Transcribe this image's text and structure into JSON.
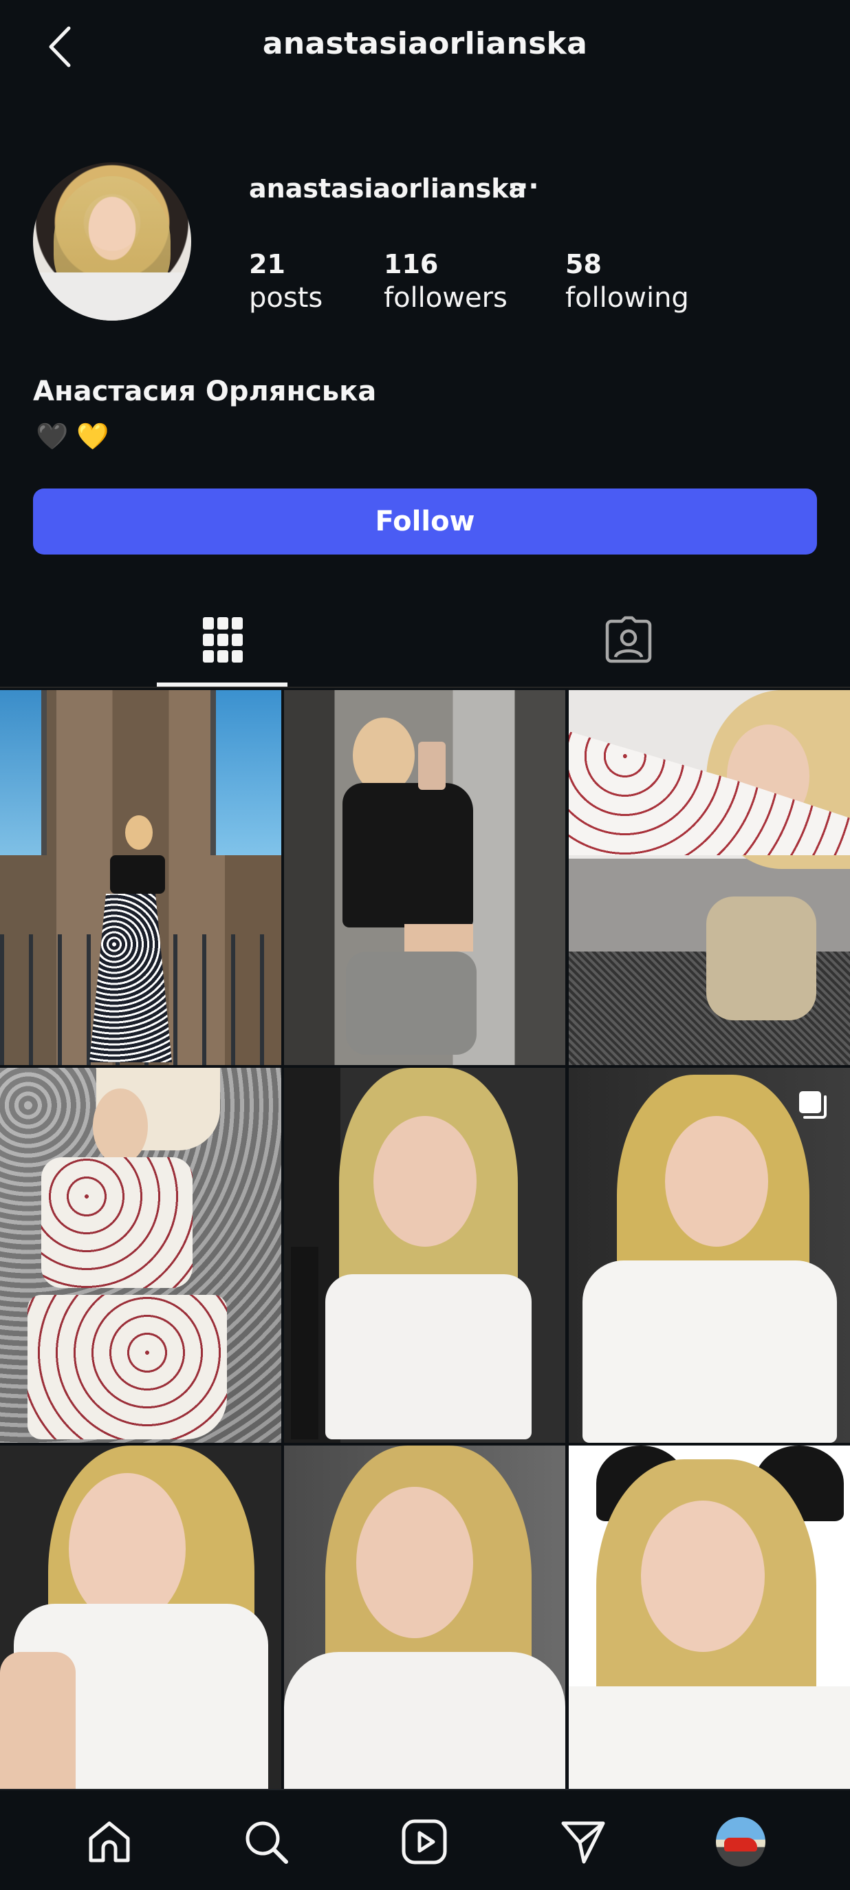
{
  "header": {
    "title": "anastasiaorlianska"
  },
  "profile": {
    "username": "anastasiaorlianska",
    "more_label": "···",
    "stats": [
      {
        "value": "21",
        "label": "posts"
      },
      {
        "value": "116",
        "label": "followers"
      },
      {
        "value": "58",
        "label": "following"
      }
    ],
    "full_name": "Анастасия Орлянська",
    "bio": "🖤 💛",
    "follow_label": "Follow"
  },
  "tabs": [
    {
      "icon": "grid-icon",
      "selected": true
    },
    {
      "icon": "tagged-icon",
      "selected": false
    }
  ],
  "posts": [
    {
      "icon": "photo",
      "multi": false
    },
    {
      "icon": "photo",
      "multi": false
    },
    {
      "icon": "photo",
      "multi": false
    },
    {
      "icon": "photo",
      "multi": false
    },
    {
      "icon": "photo",
      "multi": false
    },
    {
      "icon": "photo",
      "multi": true
    },
    {
      "icon": "photo",
      "multi": false
    },
    {
      "icon": "photo",
      "multi": false
    },
    {
      "icon": "photo",
      "multi": false
    }
  ],
  "bottom_nav": [
    "home-icon",
    "search-icon",
    "reels-icon",
    "direct-icon",
    "profile-avatar"
  ],
  "colors": {
    "background": "#0c1014",
    "follow_button": "#4a5cf4",
    "text": "#f5f5f5"
  }
}
